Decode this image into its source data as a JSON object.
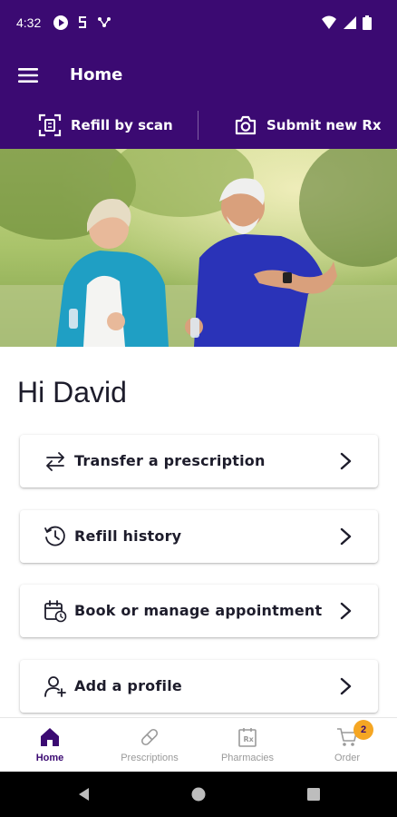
{
  "status_bar": {
    "time": "4:32",
    "icons": [
      "play-circle-icon",
      "s-app-icon",
      "connect-icon"
    ],
    "right_icons": [
      "wifi-icon",
      "signal-icon",
      "battery-icon"
    ]
  },
  "app_bar": {
    "title": "Home",
    "menu_icon": "hamburger-menu-icon"
  },
  "actions": {
    "refill_by_scan": "Refill by scan",
    "submit_new_rx": "Submit new Rx"
  },
  "hero": {
    "image": "older couple jogging outdoors in a park"
  },
  "greeting": "Hi David",
  "cards": [
    {
      "label": "Transfer a prescription",
      "icon": "transfer-arrows-icon"
    },
    {
      "label": "Refill history",
      "icon": "history-clock-icon"
    },
    {
      "label": "Book or manage appointment",
      "icon": "calendar-clock-icon"
    },
    {
      "label": "Add a profile",
      "icon": "add-user-icon"
    }
  ],
  "bottom_nav": {
    "items": [
      {
        "label": "Home",
        "icon": "home-icon",
        "active": true
      },
      {
        "label": "Prescriptions",
        "icon": "pill-icon",
        "active": false
      },
      {
        "label": "Pharmacies",
        "icon": "rx-store-icon",
        "active": false
      },
      {
        "label": "Order",
        "icon": "cart-icon",
        "active": false,
        "badge": "2"
      }
    ]
  },
  "colors": {
    "brand": "#3b0a72",
    "badge": "#f5a623",
    "text": "#1d1c2b",
    "inactive": "#9a9a9a"
  }
}
